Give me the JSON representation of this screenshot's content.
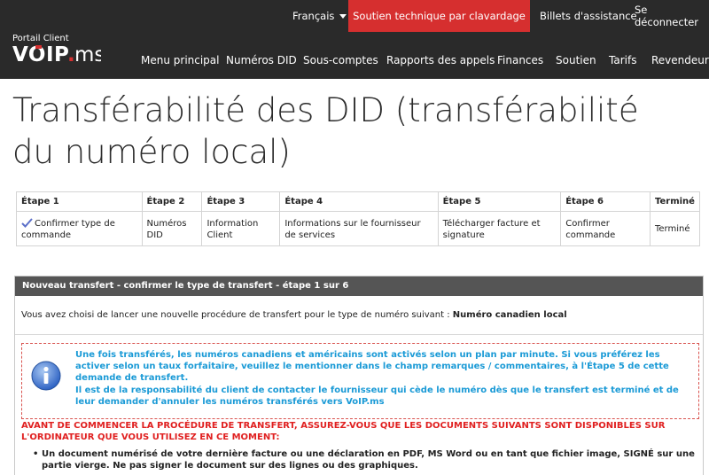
{
  "utility_bar": {
    "language": "Français",
    "chat_support": "Soutien technique par clavardage",
    "tickets": "Billets d'assistance",
    "logout": "Se déconnecter"
  },
  "brand": {
    "caption": "Portail Client",
    "logo": "VOIP.MS"
  },
  "nav": {
    "items": [
      "Menu principal",
      "Numéros DID",
      "Sous-comptes",
      "Rapports des appels",
      "Finances",
      "Soutien",
      "Tarifs",
      "Revendeur"
    ]
  },
  "page": {
    "title": "Transférabilité des DID (transférabilité du numéro local)"
  },
  "steps": {
    "headers": [
      "Étape 1",
      "Étape 2",
      "Étape 3",
      "Étape 4",
      "Étape 5",
      "Étape 6",
      "Terminé"
    ],
    "cells": [
      "Confirmer type de commande",
      "Numéros DID",
      "Information Client",
      "Informations sur le fournisseur de services",
      "Télécharger facture et signature",
      "Confirmer commande",
      "Terminé"
    ],
    "current_step": 1
  },
  "panel": {
    "header": "Nouveau transfert - confirmer le type de transfert - étape 1 sur 6",
    "intro": "Vous avez choisi de lancer une nouvelle procédure de transfert pour le type de numéro suivant :",
    "number_type": "Numéro canadien local",
    "notice_p1": "Une fois transférés, les numéros canadiens et américains sont activés selon un plan par minute. Si vous préférez les activer selon un taux forfaitaire, veuillez le mentionner dans le champ remarques / commentaires, à l'Étape 5 de cette demande de transfert.",
    "notice_p2": "Il est de la responsabilité du client de contacter le fournisseur qui cède le numéro dès que le transfert est terminé et de leur demander d'annuler les numéros transférés vers VoIP.ms",
    "warning": "AVANT DE COMMENCER LA PROCÉDURE DE TRANSFERT, ASSUREZ-VOUS QUE LES DOCUMENTS SUIVANTS SONT DISPONIBLES SUR L'ORDINATEUR QUE VOUS UTILISEZ EN CE MOMENT:",
    "bullet_1": "Un document numérisé de votre dernière facture ou une déclaration en PDF, MS Word ou en tant que fichier image, SIGNÉ sur une partie vierge. Ne pas signer le document sur des lignes ou des graphiques."
  },
  "colors": {
    "header_bg": "#2a2a2a",
    "chat_bg": "#d62f2f",
    "panel_header_bg": "#555555",
    "notice_text": "#1a9ad6",
    "warning_text": "#e02020"
  }
}
